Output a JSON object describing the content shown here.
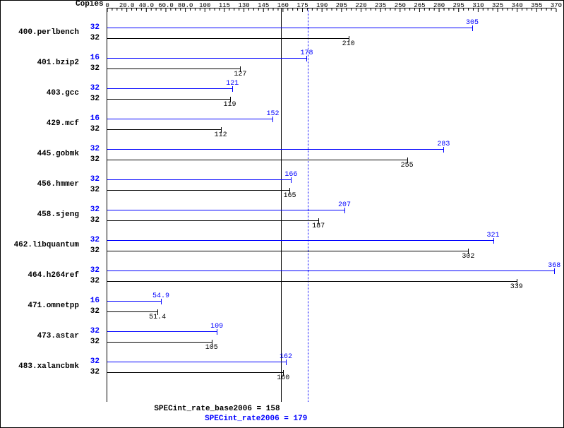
{
  "chart_data": {
    "type": "bar",
    "title": "",
    "copies_header": "Copies",
    "x": {
      "min": 0,
      "max": 370,
      "ticks": [
        0,
        20,
        40,
        60,
        80,
        100,
        115,
        130,
        145,
        160,
        175,
        190,
        205,
        220,
        235,
        250,
        265,
        280,
        295,
        310,
        325,
        340,
        355,
        370
      ],
      "tick_labels": [
        "0",
        "20.0",
        "40.0",
        "60.0",
        "80.0",
        "100",
        "115",
        "130",
        "145",
        "160",
        "175",
        "190",
        "205",
        "220",
        "235",
        "250",
        "265",
        "280",
        "295",
        "310",
        "325",
        "340",
        "355",
        "370"
      ]
    },
    "baseline_marker": {
      "value": 158,
      "label": "SPECint_rate_base2006 = 158"
    },
    "peak_marker": {
      "value": 179,
      "label": "SPECint_rate2006 = 179"
    },
    "benchmarks": [
      {
        "name": "400.perlbench",
        "peak_copies": 32,
        "peak": 305,
        "base_copies": 32,
        "base": 210
      },
      {
        "name": "401.bzip2",
        "peak_copies": 16,
        "peak": 178,
        "base_copies": 32,
        "base": 127
      },
      {
        "name": "403.gcc",
        "peak_copies": 32,
        "peak": 121,
        "base_copies": 32,
        "base": 119
      },
      {
        "name": "429.mcf",
        "peak_copies": 16,
        "peak": 152,
        "base_copies": 32,
        "base": 112
      },
      {
        "name": "445.gobmk",
        "peak_copies": 32,
        "peak": 283,
        "base_copies": 32,
        "base": 255
      },
      {
        "name": "456.hmmer",
        "peak_copies": 32,
        "peak": 166,
        "base_copies": 32,
        "base": 165
      },
      {
        "name": "458.sjeng",
        "peak_copies": 32,
        "peak": 207,
        "base_copies": 32,
        "base": 187
      },
      {
        "name": "462.libquantum",
        "peak_copies": 32,
        "peak": 321,
        "base_copies": 32,
        "base": 302
      },
      {
        "name": "464.h264ref",
        "peak_copies": 32,
        "peak": 368,
        "base_copies": 32,
        "base": 339
      },
      {
        "name": "471.omnetpp",
        "peak_copies": 16,
        "peak": 54.9,
        "base_copies": 32,
        "base": 51.4
      },
      {
        "name": "473.astar",
        "peak_copies": 32,
        "peak": 109,
        "base_copies": 32,
        "base": 105
      },
      {
        "name": "483.xalancbmk",
        "peak_copies": 32,
        "peak": 162,
        "base_copies": 32,
        "base": 160
      }
    ]
  }
}
